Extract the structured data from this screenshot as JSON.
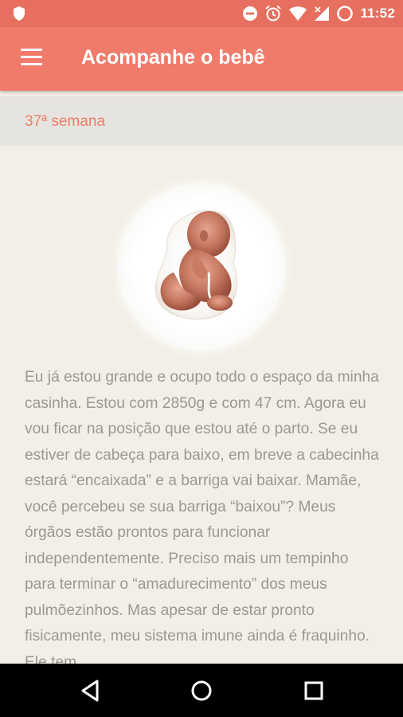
{
  "status_bar": {
    "time": "11:52",
    "icons": [
      "shield-icon",
      "do-not-disturb-icon",
      "alarm-icon",
      "wifi-icon",
      "signal-icon",
      "battery-icon"
    ]
  },
  "app_bar": {
    "title": "Acompanhe o bebê",
    "menu_icon": "hamburger-menu-icon"
  },
  "week": {
    "label": "37ª semana"
  },
  "baby": {
    "image": "fetus-illustration"
  },
  "description": "Eu já estou grande e ocupo todo o espaço da minha casinha. Estou com 2850g e com 47 cm. Agora eu vou ficar na posição que estou até o parto. Se eu estiver de cabeça para baixo, em breve a cabecinha estará “encaixada” e a barriga vai baixar. Mamãe, você percebeu se sua barriga “baixou”? Meus órgãos estão prontos para funcionar independentemente. Preciso mais um tempinho para terminar o “amadurecimento” dos meus pulmõezinhos. Mas apesar de estar pronto fisicamente, meu sistema imune ainda é fraquinho. Ele tem",
  "nav_bar": {
    "items": [
      "back-icon",
      "home-icon",
      "recents-icon"
    ]
  },
  "colors": {
    "app_bar": "#f07b6b",
    "status_bar": "#e76f5f",
    "accent_text": "#ef7d6a",
    "body_text": "#9c9890",
    "background": "#f2efe6",
    "week_bar": "#e6e4de"
  }
}
